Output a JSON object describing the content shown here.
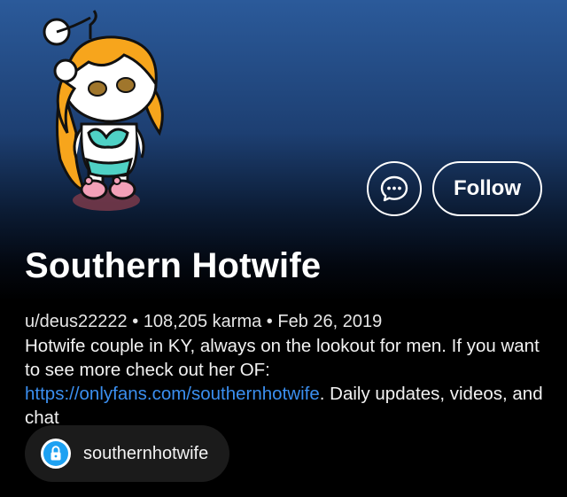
{
  "profile": {
    "display_name": "Southern Hotwife",
    "username": "u/deus22222",
    "separator": "•",
    "karma": "108,205 karma",
    "cake_day": "Feb 26, 2019",
    "bio_text_1": "Hotwife couple in KY, always on the lookout for men. If you want to see more check out her OF: ",
    "bio_link": "https://onlyfans.com/southernhotwife",
    "bio_text_2": ". Daily updates, videos, and chat"
  },
  "actions": {
    "chat_icon": "chat-bubble-ellipsis-icon",
    "follow_label": "Follow"
  },
  "social_link": {
    "icon": "onlyfans-lock-icon",
    "label": "southernhotwife",
    "accent": "#1da1f2"
  },
  "colors": {
    "header_top": "#2b5a9a",
    "background": "#000000",
    "link": "#3b8ff0",
    "chip_bg": "#1b1b1b"
  }
}
